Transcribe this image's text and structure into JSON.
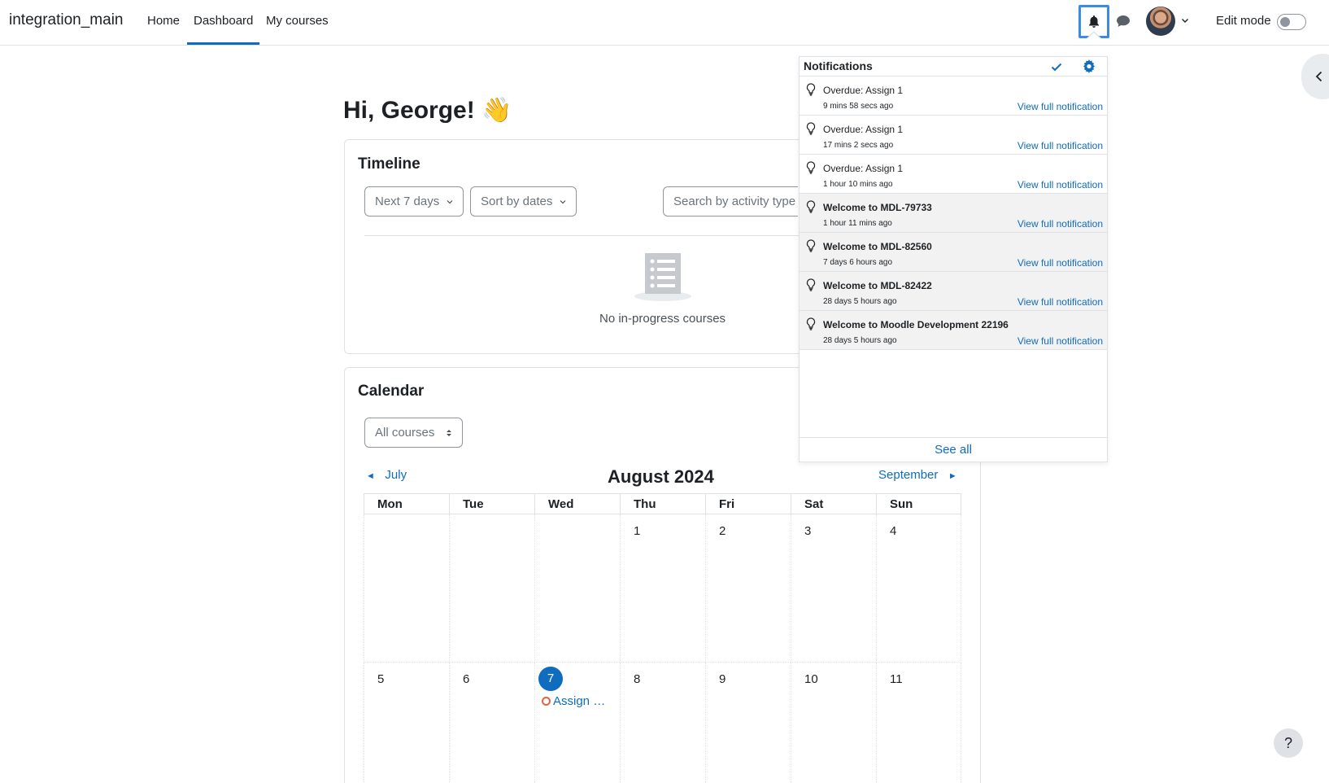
{
  "navbar": {
    "brand": "integration_main",
    "links": [
      {
        "label": "Home"
      },
      {
        "label": "Dashboard",
        "active": true
      },
      {
        "label": "My courses"
      }
    ],
    "edit_mode_label": "Edit mode",
    "edit_mode_on": false
  },
  "page": {
    "greeting": "Hi, George! 👋"
  },
  "timeline": {
    "title": "Timeline",
    "filter_label": "Next 7 days",
    "sort_label": "Sort by dates",
    "search_placeholder": "Search by activity type or name",
    "empty_text": "No in-progress courses"
  },
  "calendar": {
    "title": "Calendar",
    "course_filter": "All courses",
    "prev_label": "July",
    "next_label": "September",
    "month_label": "August 2024",
    "weekdays": [
      "Mon",
      "Tue",
      "Wed",
      "Thu",
      "Fri",
      "Sat",
      "Sun"
    ],
    "weeks": [
      [
        "",
        "",
        "",
        "1",
        "2",
        "3",
        "4"
      ],
      [
        "5",
        "6",
        "7",
        "8",
        "9",
        "10",
        "11"
      ]
    ],
    "today": "7",
    "event": {
      "day": "7",
      "label": "Assign …"
    }
  },
  "notifications": {
    "title": "Notifications",
    "footer": "See all",
    "view_label": "View full notification",
    "items": [
      {
        "subject": "Overdue: Assign 1",
        "time": "9 mins 58 secs ago",
        "unread": false
      },
      {
        "subject": "Overdue: Assign 1",
        "time": "17 mins 2 secs ago",
        "unread": false
      },
      {
        "subject": "Overdue: Assign 1",
        "time": "1 hour 10 mins ago",
        "unread": false
      },
      {
        "subject": "Welcome to MDL-79733",
        "time": "1 hour 11 mins ago",
        "unread": true
      },
      {
        "subject": "Welcome to MDL-82560",
        "time": "7 days 6 hours ago",
        "unread": true
      },
      {
        "subject": "Welcome to MDL-82422",
        "time": "28 days 5 hours ago",
        "unread": true
      },
      {
        "subject": "Welcome to Moodle Development 22196",
        "time": "28 days 5 hours ago",
        "unread": true
      }
    ]
  },
  "help": {
    "label": "?"
  },
  "colors": {
    "accent": "#0f6cbf",
    "event": "#e0653e",
    "border": "#dee2e6"
  }
}
